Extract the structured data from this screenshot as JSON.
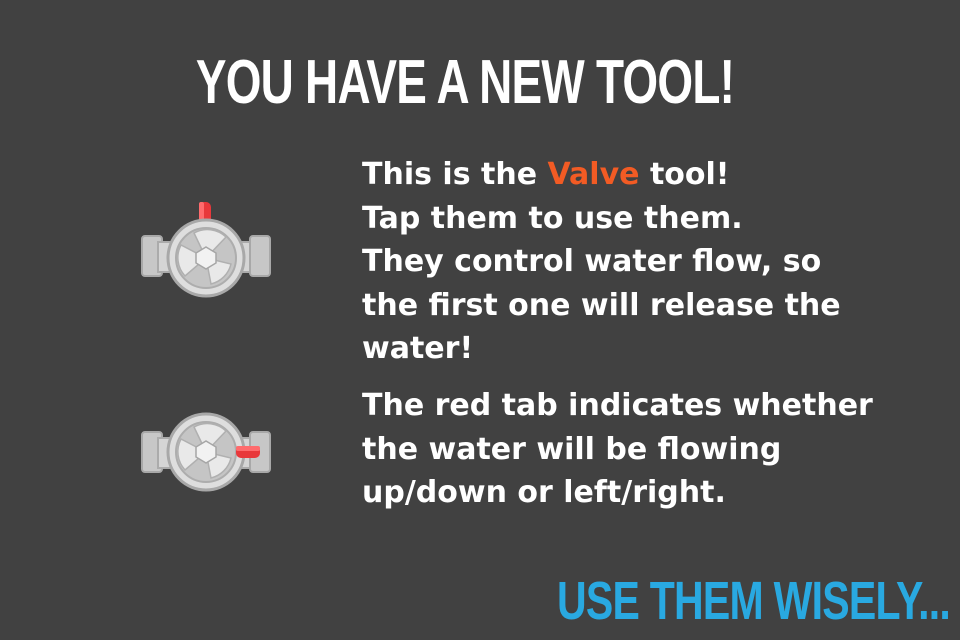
{
  "screen": {
    "title": "YOU HAVE A NEW TOOL!",
    "footer": "USE THEM WISELY..."
  },
  "intro": {
    "line1_before": "This is the ",
    "tool_name": "Valve",
    "line1_after": " tool!",
    "lines": [
      "Tap them to use them.",
      "They control water flow, so",
      "the first one will release the",
      "water!"
    ]
  },
  "tab_info": {
    "lines": [
      "The red tab indicates whether",
      "the water will be flowing",
      "up/down or left/right."
    ]
  },
  "icons": {
    "valve_vertical_tab": "valve-icon",
    "valve_horizontal_tab": "valve-icon"
  },
  "colors": {
    "background": "#414141",
    "title_text": "#ffffff",
    "body_text": "#ffffff",
    "highlight": "#f25b24",
    "footer_text": "#29a9e1",
    "valve_tab": "#e8383b",
    "valve_metal": "#d4d4d4"
  }
}
